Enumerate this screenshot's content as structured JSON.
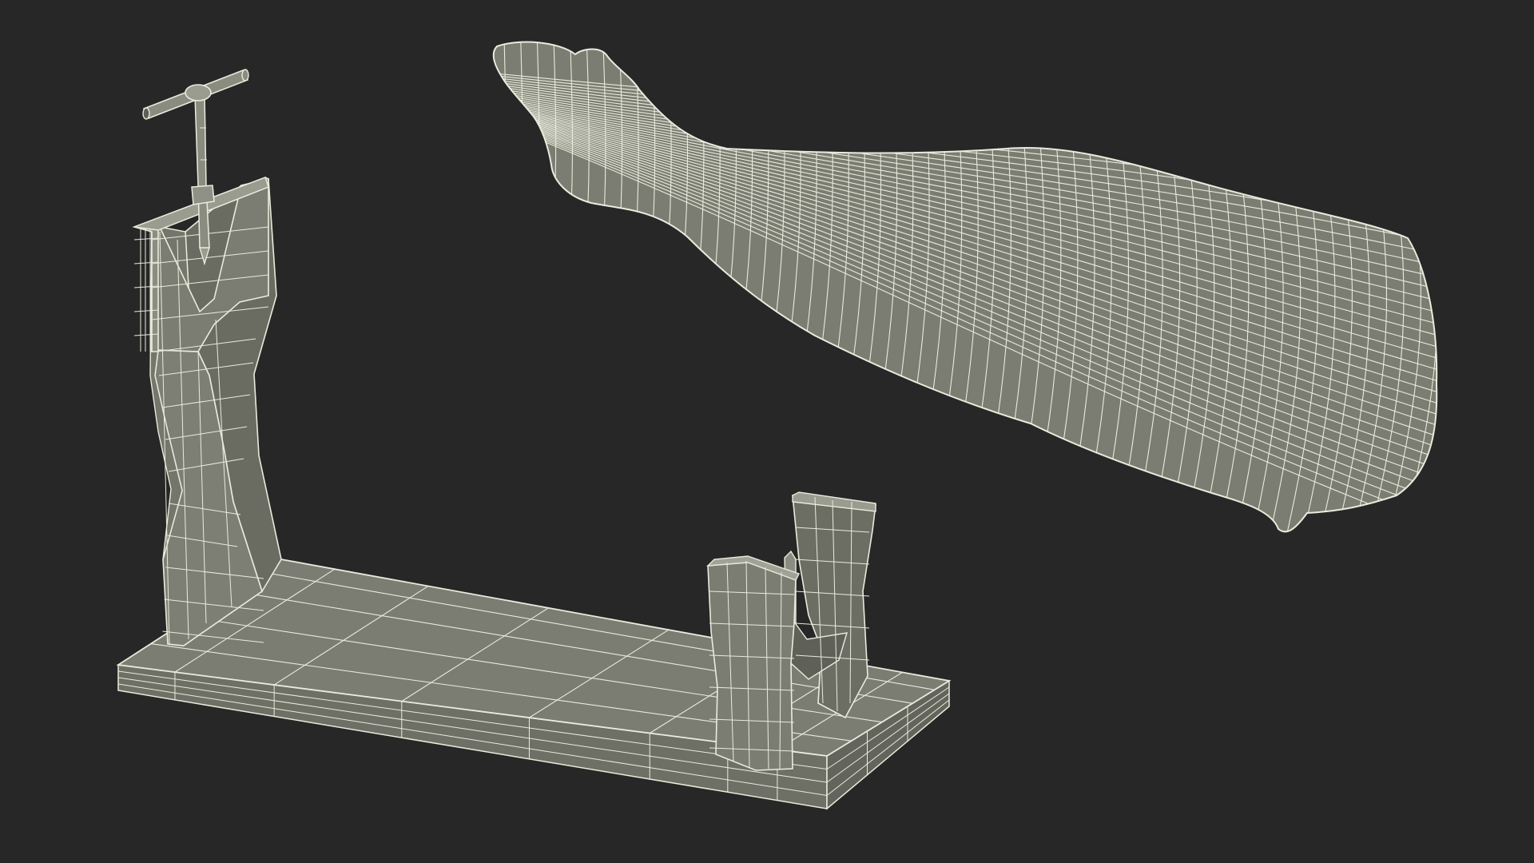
{
  "scene": {
    "background_color": "#272727",
    "mesh_fill_color": "#7b7d72",
    "mesh_shade_color": "#6a6c62",
    "mesh_dark_color": "#5d5f56",
    "wire_color": "#e9ebdc",
    "objects": [
      "ham-holder-stand",
      "ham-leg"
    ]
  }
}
